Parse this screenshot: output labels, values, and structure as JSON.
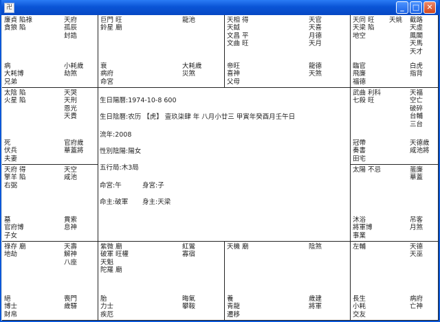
{
  "window": {
    "app_icon_glyph": "卍"
  },
  "center": {
    "birth_solar": "生日陽曆:1974-10-8 600",
    "birth_lunar": "生日陰曆:农历 【虎】 壹玖柒肆 年 八月小廿三 甲寅年癸酉月壬午日",
    "liu_nian": "流年:2008",
    "gender": "性別陰陽:陽女",
    "wuxing": "五行局:木3局",
    "ming_gong": "命宮:午",
    "shen_gong": "身宮:子",
    "ming_zhu": "命主:破軍",
    "shen_zhu": "身主:天梁"
  },
  "cells": {
    "sishi": {
      "left": [
        "廉貞 陷祿",
        "貪狼 陷"
      ],
      "right": [
        "天府",
        "孤辰",
        "封誥"
      ],
      "bottom": [
        "病",
        "大耗博",
        "兄弟"
      ],
      "bottom_right": [
        "小耗歲",
        "劫煞"
      ]
    },
    "wu": {
      "left": [
        "巨門 旺",
        "鈴星 廟"
      ],
      "right": [
        "龍池"
      ],
      "bottom": [
        "衰",
        "病府",
        "命宮"
      ],
      "bottom_right": [
        "大耗歲",
        "災煞"
      ]
    },
    "wei": {
      "left": [
        "天相 得",
        "天鉞",
        "文昌 平",
        "文曲 旺"
      ],
      "right": [
        "天官",
        "天喜",
        "月德",
        "天月"
      ],
      "bottom": [
        "帝旺",
        "喜神",
        "父母"
      ],
      "bottom_right": [
        "龍德",
        "天煞"
      ]
    },
    "shen": {
      "left": [
        "天同 旺",
        "天梁 陷",
        "地空"
      ],
      "right2": [
        "天姚"
      ],
      "right": [
        "截路",
        "天虛",
        "鳳閣",
        "天馬",
        "天才"
      ],
      "bottom": [
        "臨官",
        "飛廉",
        "福德"
      ],
      "bottom_right": [
        "白虎",
        "指背"
      ]
    },
    "chen": {
      "left": [
        "太陰 陷",
        "火星 陷"
      ],
      "right": [
        "天哭",
        "天刑",
        "恩光",
        "天貴"
      ],
      "bottom": [
        "死",
        "伏兵",
        "夫妻"
      ],
      "bottom_right": [
        "官府歲",
        "華蓋將"
      ]
    },
    "you": {
      "left": [
        "武曲 利科",
        "七殺 旺"
      ],
      "right": [
        "天福",
        "空亡",
        "破碎",
        "台輔",
        "三台"
      ],
      "bottom": [
        "冠帶",
        "奏書",
        "田宅"
      ],
      "bottom_right": [
        "天德歲",
        "咸池將"
      ]
    },
    "mao": {
      "left": [
        "天府 得",
        "擎羊 陷",
        "右弼"
      ],
      "right": [
        "天空",
        "咸池"
      ],
      "bottom": [
        "墓",
        "官府博",
        "子女"
      ],
      "bottom_right": [
        "貫索",
        "息神"
      ]
    },
    "xu": {
      "left": [
        "太陽 不忌"
      ],
      "right": [
        "蜚廉",
        "華蓋"
      ],
      "bottom": [
        "沐浴",
        "將軍博",
        "事業"
      ],
      "bottom_right": [
        "吊客",
        "月煞"
      ]
    },
    "yin": {
      "left": [
        "祿存 廟",
        "地劫"
      ],
      "right": [
        "天壽",
        "解神",
        "八座"
      ],
      "bottom": [
        "絕",
        "博士",
        "財帛"
      ],
      "bottom_right": [
        "喪門",
        "歲驛"
      ]
    },
    "chou": {
      "left": [
        "紫微 廟",
        "破軍 旺權",
        "天魁",
        "陀羅 廟"
      ],
      "right": [
        "紅鸞",
        "寡宿"
      ],
      "bottom": [
        "胎",
        "力士",
        "疾厄"
      ],
      "bottom_right": [
        "晦氣",
        "攀鞍"
      ]
    },
    "zi": {
      "left": [
        "天機 廟"
      ],
      "right": [
        "陰煞"
      ],
      "bottom": [
        "養",
        "青龍",
        "遷移"
      ],
      "bottom_right": [
        "歲建",
        "將軍"
      ]
    },
    "hai": {
      "left": [
        "左輔"
      ],
      "right": [
        "天德",
        "天巫"
      ],
      "bottom": [
        "長生",
        "小耗",
        "交友"
      ],
      "bottom_right": [
        "病府",
        "亡神"
      ]
    }
  }
}
